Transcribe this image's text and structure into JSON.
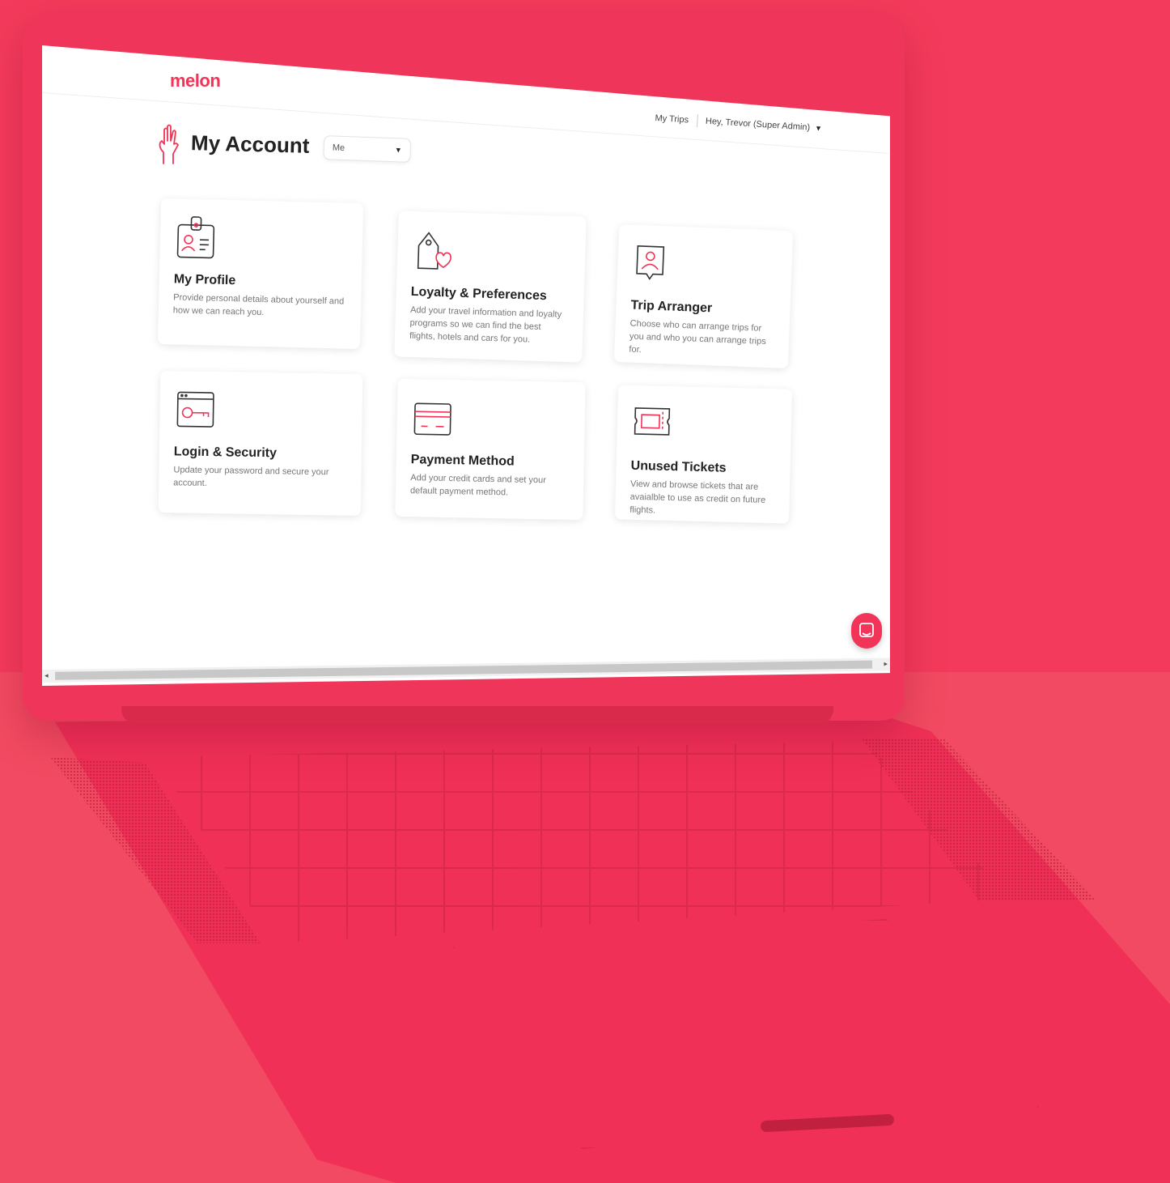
{
  "brand": {
    "logo": "melon",
    "accent": "#f13457",
    "background": "#f43a5c"
  },
  "topnav": {
    "my_trips": "My Trips",
    "user_greeting": "Hey, Trevor (Super Admin)"
  },
  "header": {
    "title": "My Account",
    "account_select": "Me"
  },
  "cards": [
    {
      "title": "My Profile",
      "desc": "Provide personal details about yourself and how we can reach you.",
      "icon": "id-badge-icon"
    },
    {
      "title": "Loyalty & Preferences",
      "desc": "Add your travel information and loyalty programs so we can find the best flights, hotels and cars for you.",
      "icon": "heart-tag-icon"
    },
    {
      "title": "Trip Arranger",
      "desc": "Choose who can arrange trips for you and who you can arrange trips for.",
      "icon": "user-bubble-icon"
    },
    {
      "title": "Login & Security",
      "desc": "Update your password and secure your account.",
      "icon": "key-window-icon"
    },
    {
      "title": "Payment Method",
      "desc": "Add your credit cards and set your default payment method.",
      "icon": "credit-card-icon"
    },
    {
      "title": "Unused Tickets",
      "desc": "View and browse tickets that are avaialble to use as credit on future flights.",
      "icon": "ticket-icon"
    }
  ],
  "icons": {
    "chat": "chat-icon",
    "hand": "peace-hand-icon",
    "caret": "chevron-down-icon"
  }
}
